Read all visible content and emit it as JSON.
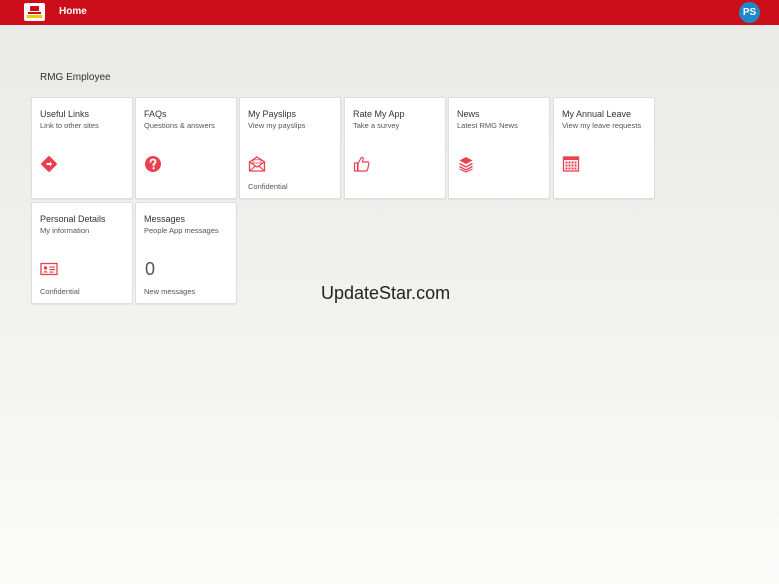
{
  "header": {
    "nav_home": "Home",
    "avatar_initials": "PS",
    "brand_color": "#cc0d1a",
    "avatar_color": "#1e88c9"
  },
  "main": {
    "section_title": "RMG Employee",
    "tiles": [
      {
        "title": "Useful Links",
        "subtitle": "Link to other sites",
        "icon": "signpost-icon",
        "footer": ""
      },
      {
        "title": "FAQs",
        "subtitle": "Questions & answers",
        "icon": "question-icon",
        "footer": ""
      },
      {
        "title": "My Payslips",
        "subtitle": "View my payslips",
        "icon": "envelope-icon",
        "footer": "Confidential"
      },
      {
        "title": "Rate My App",
        "subtitle": "Take a survey",
        "icon": "thumbs-up-icon",
        "footer": ""
      },
      {
        "title": "News",
        "subtitle": "Latest RMG News",
        "icon": "news-stack-icon",
        "footer": ""
      },
      {
        "title": "My Annual Leave",
        "subtitle": "View my leave requests",
        "icon": "calendar-icon",
        "footer": ""
      },
      {
        "title": "Personal Details",
        "subtitle": "My information",
        "icon": "id-card-icon",
        "footer": "Confidential"
      },
      {
        "title": "Messages",
        "subtitle": "People App messages",
        "count": "0",
        "footer": "New messages"
      }
    ],
    "icon_color": "#e8404f"
  },
  "watermark": "UpdateStar.com"
}
